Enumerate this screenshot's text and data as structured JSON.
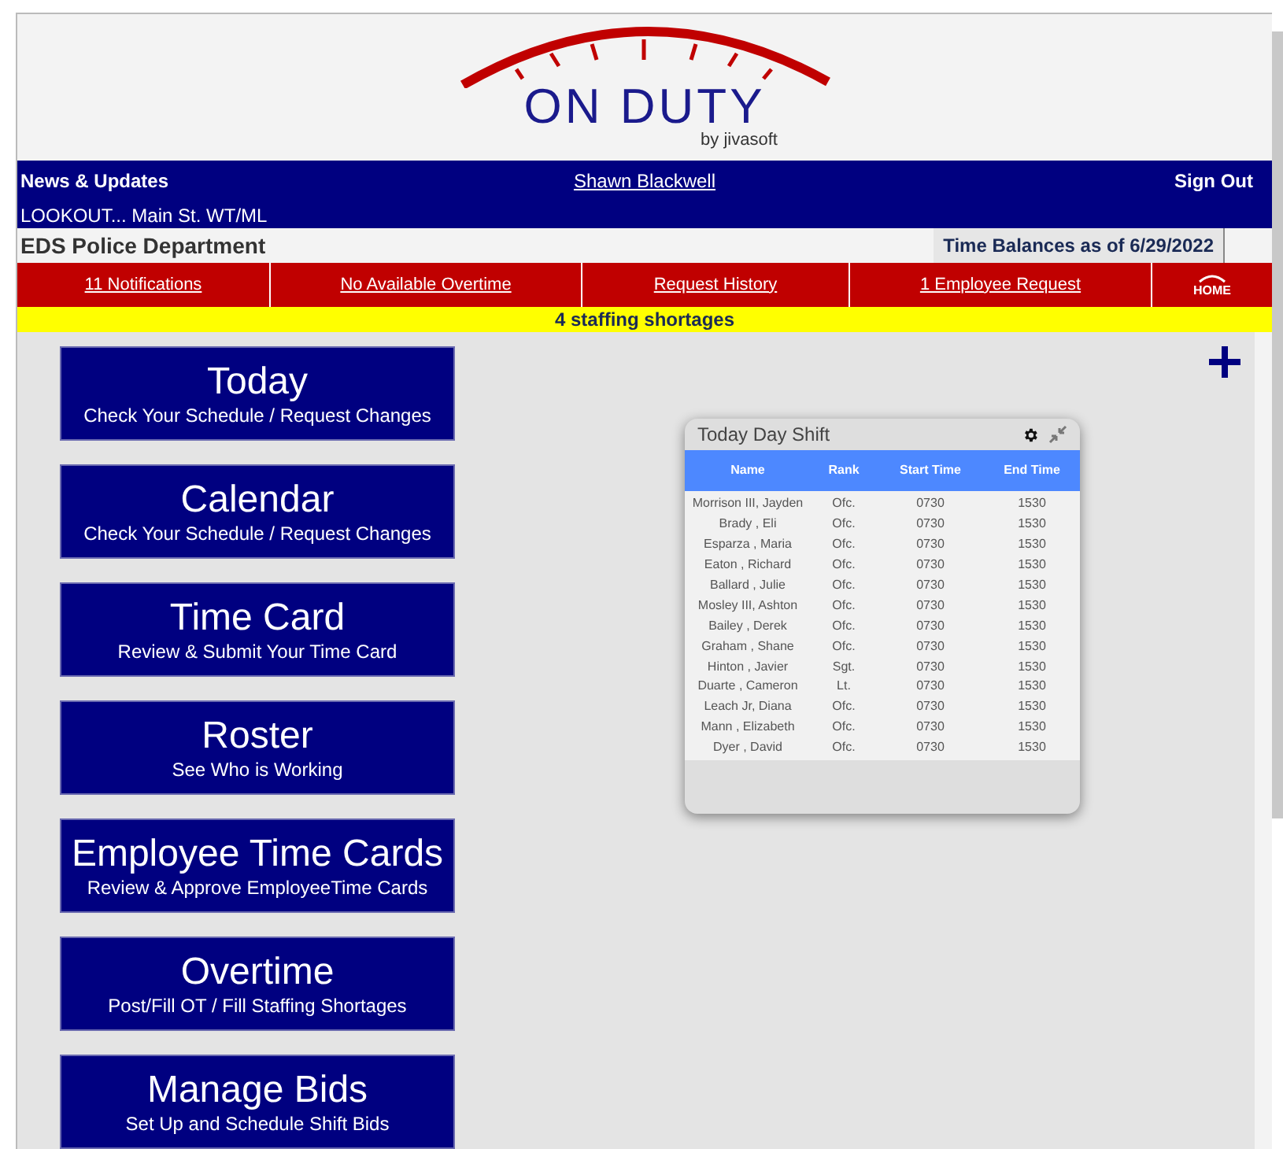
{
  "logo": {
    "title": "ON DUTY",
    "byline": "by jivasoft"
  },
  "top_bar": {
    "news_label": "News & Updates",
    "user": "Shawn Blackwell",
    "sign_out": "Sign Out",
    "news_text": "LOOKOUT... Main St. WT/ML"
  },
  "department": "EDS Police Department",
  "time_balances": "Time Balances as of 6/29/2022",
  "nav": [
    {
      "label": "11 Notifications"
    },
    {
      "label": "No Available Overtime"
    },
    {
      "label": "Request History"
    },
    {
      "label": "1 Employee Request"
    }
  ],
  "home": "HOME",
  "alert": "4 staffing shortages",
  "menu": [
    {
      "title": "Today",
      "subtitle": "Check Your Schedule / Request Changes"
    },
    {
      "title": "Calendar",
      "subtitle": "Check Your Schedule / Request Changes"
    },
    {
      "title": "Time Card",
      "subtitle": "Review & Submit Your Time Card"
    },
    {
      "title": "Roster",
      "subtitle": "See Who is Working"
    },
    {
      "title": "Employee Time Cards",
      "subtitle": "Review & Approve EmployeeTime Cards"
    },
    {
      "title": "Overtime",
      "subtitle": "Post/Fill OT / Fill Staffing Shortages"
    },
    {
      "title": "Manage Bids",
      "subtitle": "Set Up and Schedule Shift Bids"
    }
  ],
  "widget": {
    "title": "Today Day Shift",
    "columns": [
      "Name",
      "Rank",
      "Start Time",
      "End Time"
    ],
    "rows": [
      [
        "Morrison III, Jayden",
        "Ofc.",
        "0730",
        "1530"
      ],
      [
        "Brady , Eli",
        "Ofc.",
        "0730",
        "1530"
      ],
      [
        "Esparza , Maria",
        "Ofc.",
        "0730",
        "1530"
      ],
      [
        "Eaton , Richard",
        "Ofc.",
        "0730",
        "1530"
      ],
      [
        "Ballard , Julie",
        "Ofc.",
        "0730",
        "1530"
      ],
      [
        "Mosley III, Ashton",
        "Ofc.",
        "0730",
        "1530"
      ],
      [
        "Bailey , Derek",
        "Ofc.",
        "0730",
        "1530"
      ],
      [
        "Graham , Shane",
        "Ofc.",
        "0730",
        "1530"
      ],
      [
        "Hinton , Javier",
        "Sgt.",
        "0730",
        "1530"
      ],
      [
        "Duarte , Cameron",
        "Lt.",
        "0730",
        "1530"
      ],
      [
        "Leach Jr, Diana",
        "Ofc.",
        "0730",
        "1530"
      ],
      [
        "Mann , Elizabeth",
        "Ofc.",
        "0730",
        "1530"
      ],
      [
        "Dyer , David",
        "Ofc.",
        "0730",
        "1530"
      ]
    ]
  }
}
